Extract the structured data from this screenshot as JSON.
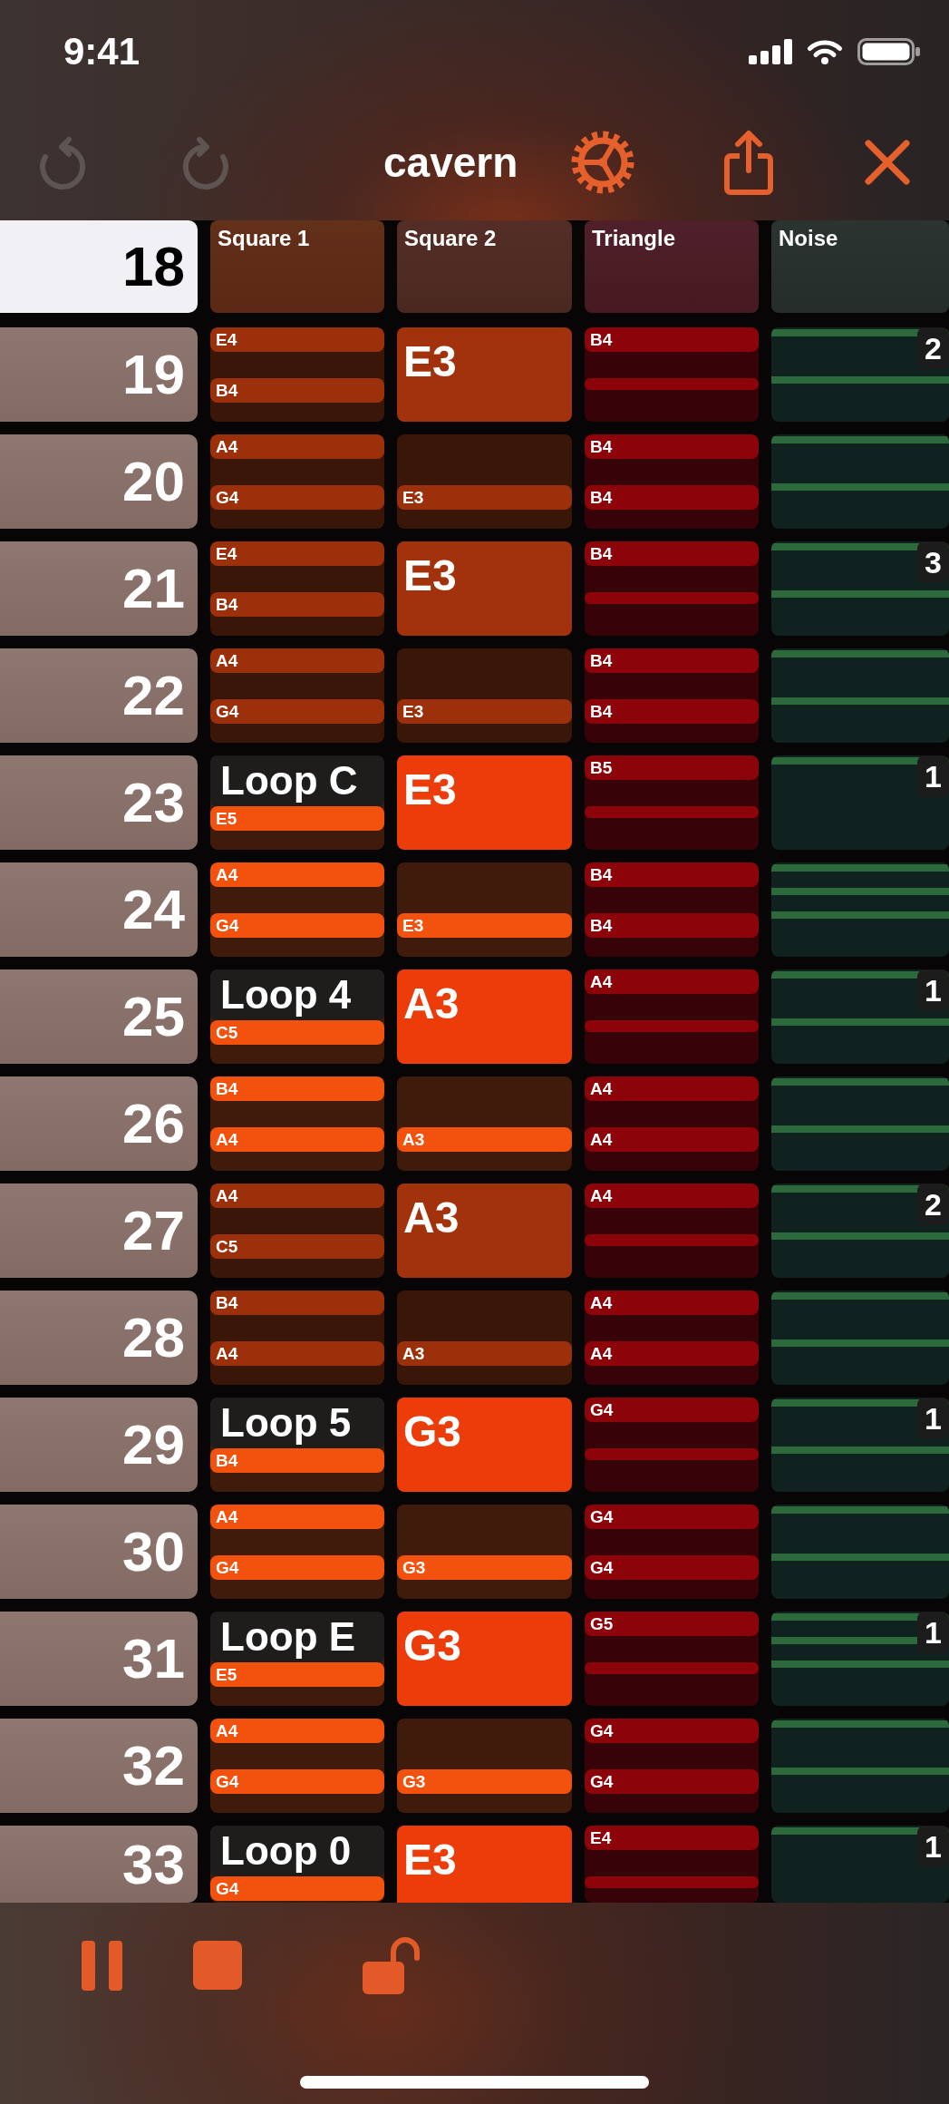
{
  "status_bar": {
    "time": "9:41"
  },
  "toolbar": {
    "undo": {
      "disabled": true
    },
    "redo": {
      "disabled": true
    },
    "title": "cavern"
  },
  "tracker": {
    "current_row": {
      "number": "18",
      "selected": true
    },
    "columns": [
      {
        "kind": "square",
        "label": "Square 1"
      },
      {
        "kind": "square",
        "label": "Square 2"
      },
      {
        "kind": "triangle",
        "label": "Triangle"
      },
      {
        "kind": "noise",
        "label": "Noise"
      }
    ],
    "rows": [
      {
        "number": "19",
        "selected": false,
        "cells": [
          {
            "bright": false,
            "slots": [
              {
                "kind": "note",
                "label": "E4"
              },
              {
                "kind": "note",
                "label": "B4"
              }
            ]
          },
          {
            "bright": false,
            "slots": [
              {
                "kind": "block",
                "label": "E3"
              }
            ]
          },
          {
            "slots": [
              {
                "kind": "note",
                "label": "B4"
              },
              {
                "kind": "bar"
              }
            ]
          },
          {
            "badge": "2",
            "steps": [
              {
                "on": true
              },
              {
                "on": false
              },
              {
                "on": true
              },
              {
                "on": false
              }
            ]
          }
        ]
      },
      {
        "number": "20",
        "selected": false,
        "cells": [
          {
            "bright": false,
            "slots": [
              {
                "kind": "note",
                "label": "A4"
              },
              {
                "kind": "note",
                "label": "G4"
              }
            ]
          },
          {
            "bright": false,
            "slots": [
              {
                "kind": "rest"
              },
              {
                "kind": "note",
                "label": "E3"
              }
            ]
          },
          {
            "slots": [
              {
                "kind": "note",
                "label": "B4"
              },
              {
                "kind": "note",
                "label": "B4"
              }
            ]
          },
          {
            "steps": [
              {
                "on": true
              },
              {
                "on": false
              },
              {
                "on": true
              },
              {
                "on": false
              }
            ]
          }
        ]
      },
      {
        "number": "21",
        "selected": false,
        "cells": [
          {
            "bright": false,
            "slots": [
              {
                "kind": "note",
                "label": "E4"
              },
              {
                "kind": "note",
                "label": "B4"
              }
            ]
          },
          {
            "bright": false,
            "slots": [
              {
                "kind": "block",
                "label": "E3"
              }
            ]
          },
          {
            "slots": [
              {
                "kind": "note",
                "label": "B4"
              },
              {
                "kind": "bar"
              }
            ]
          },
          {
            "badge": "3",
            "steps": [
              {
                "on": true
              },
              {
                "on": false
              },
              {
                "on": true
              },
              {
                "on": false
              }
            ]
          }
        ]
      },
      {
        "number": "22",
        "selected": false,
        "cells": [
          {
            "bright": false,
            "slots": [
              {
                "kind": "note",
                "label": "A4"
              },
              {
                "kind": "note",
                "label": "G4"
              }
            ]
          },
          {
            "bright": false,
            "slots": [
              {
                "kind": "rest"
              },
              {
                "kind": "note",
                "label": "E3"
              }
            ]
          },
          {
            "slots": [
              {
                "kind": "note",
                "label": "B4"
              },
              {
                "kind": "note",
                "label": "B4"
              }
            ]
          },
          {
            "steps": [
              {
                "on": true
              },
              {
                "on": false
              },
              {
                "on": true
              },
              {
                "on": false
              }
            ]
          }
        ]
      },
      {
        "number": "23",
        "selected": false,
        "cells": [
          {
            "bright": true,
            "slots": [
              {
                "kind": "loop",
                "label": "Loop C"
              },
              {
                "kind": "note",
                "label": "E5"
              }
            ]
          },
          {
            "bright": true,
            "slots": [
              {
                "kind": "block",
                "label": "E3"
              }
            ]
          },
          {
            "slots": [
              {
                "kind": "note",
                "label": "B5"
              },
              {
                "kind": "bar"
              }
            ]
          },
          {
            "badge": "1",
            "steps": [
              {
                "on": true
              },
              {
                "on": false
              },
              {
                "on": false
              },
              {
                "on": false
              }
            ]
          }
        ]
      },
      {
        "number": "24",
        "selected": false,
        "cells": [
          {
            "bright": true,
            "slots": [
              {
                "kind": "note",
                "label": "A4"
              },
              {
                "kind": "note",
                "label": "G4"
              }
            ]
          },
          {
            "bright": true,
            "slots": [
              {
                "kind": "rest"
              },
              {
                "kind": "note",
                "label": "E3"
              }
            ]
          },
          {
            "slots": [
              {
                "kind": "note",
                "label": "B4"
              },
              {
                "kind": "note",
                "label": "B4"
              }
            ]
          },
          {
            "steps": [
              {
                "on": true
              },
              {
                "on": true
              },
              {
                "on": true
              },
              {
                "on": false
              }
            ]
          }
        ]
      },
      {
        "number": "25",
        "selected": false,
        "cells": [
          {
            "bright": true,
            "slots": [
              {
                "kind": "loop",
                "label": "Loop 4"
              },
              {
                "kind": "note",
                "label": "C5"
              }
            ]
          },
          {
            "bright": true,
            "slots": [
              {
                "kind": "block",
                "label": "A3"
              }
            ]
          },
          {
            "slots": [
              {
                "kind": "note",
                "label": "A4"
              },
              {
                "kind": "bar"
              }
            ]
          },
          {
            "badge": "1",
            "steps": [
              {
                "on": true
              },
              {
                "on": false
              },
              {
                "on": true
              },
              {
                "on": false
              }
            ]
          }
        ]
      },
      {
        "number": "26",
        "selected": false,
        "cells": [
          {
            "bright": true,
            "slots": [
              {
                "kind": "note",
                "label": "B4"
              },
              {
                "kind": "note",
                "label": "A4"
              }
            ]
          },
          {
            "bright": true,
            "slots": [
              {
                "kind": "rest"
              },
              {
                "kind": "note",
                "label": "A3"
              }
            ]
          },
          {
            "slots": [
              {
                "kind": "note",
                "label": "A4"
              },
              {
                "kind": "note",
                "label": "A4"
              }
            ]
          },
          {
            "steps": [
              {
                "on": true
              },
              {
                "on": false
              },
              {
                "on": true
              },
              {
                "on": false
              }
            ]
          }
        ]
      },
      {
        "number": "27",
        "selected": false,
        "cells": [
          {
            "bright": false,
            "slots": [
              {
                "kind": "note",
                "label": "A4"
              },
              {
                "kind": "note",
                "label": "C5"
              }
            ]
          },
          {
            "bright": false,
            "slots": [
              {
                "kind": "block",
                "label": "A3"
              }
            ]
          },
          {
            "slots": [
              {
                "kind": "note",
                "label": "A4"
              },
              {
                "kind": "bar"
              }
            ]
          },
          {
            "badge": "2",
            "steps": [
              {
                "on": true
              },
              {
                "on": false
              },
              {
                "on": true
              },
              {
                "on": false
              }
            ]
          }
        ]
      },
      {
        "number": "28",
        "selected": false,
        "cells": [
          {
            "bright": false,
            "slots": [
              {
                "kind": "note",
                "label": "B4"
              },
              {
                "kind": "note",
                "label": "A4"
              }
            ]
          },
          {
            "bright": false,
            "slots": [
              {
                "kind": "rest"
              },
              {
                "kind": "note",
                "label": "A3"
              }
            ]
          },
          {
            "slots": [
              {
                "kind": "note",
                "label": "A4"
              },
              {
                "kind": "note",
                "label": "A4"
              }
            ]
          },
          {
            "steps": [
              {
                "on": true
              },
              {
                "on": false
              },
              {
                "on": true
              },
              {
                "on": false
              }
            ]
          }
        ]
      },
      {
        "number": "29",
        "selected": false,
        "cells": [
          {
            "bright": true,
            "slots": [
              {
                "kind": "loop",
                "label": "Loop 5"
              },
              {
                "kind": "note",
                "label": "B4"
              }
            ]
          },
          {
            "bright": true,
            "slots": [
              {
                "kind": "block",
                "label": "G3"
              }
            ]
          },
          {
            "slots": [
              {
                "kind": "note",
                "label": "G4"
              },
              {
                "kind": "bar"
              }
            ]
          },
          {
            "badge": "1",
            "steps": [
              {
                "on": true
              },
              {
                "on": false
              },
              {
                "on": true
              },
              {
                "on": false
              }
            ]
          }
        ]
      },
      {
        "number": "30",
        "selected": false,
        "cells": [
          {
            "bright": true,
            "slots": [
              {
                "kind": "note",
                "label": "A4"
              },
              {
                "kind": "note",
                "label": "G4"
              }
            ]
          },
          {
            "bright": true,
            "slots": [
              {
                "kind": "rest"
              },
              {
                "kind": "note",
                "label": "G3"
              }
            ]
          },
          {
            "slots": [
              {
                "kind": "note",
                "label": "G4"
              },
              {
                "kind": "note",
                "label": "G4"
              }
            ]
          },
          {
            "steps": [
              {
                "on": true
              },
              {
                "on": false
              },
              {
                "on": true
              },
              {
                "on": false
              }
            ]
          }
        ]
      },
      {
        "number": "31",
        "selected": false,
        "cells": [
          {
            "bright": true,
            "slots": [
              {
                "kind": "loop",
                "label": "Loop E"
              },
              {
                "kind": "note",
                "label": "E5"
              }
            ]
          },
          {
            "bright": true,
            "slots": [
              {
                "kind": "block",
                "label": "G3"
              }
            ]
          },
          {
            "slots": [
              {
                "kind": "note",
                "label": "G5"
              },
              {
                "kind": "bar"
              }
            ]
          },
          {
            "badge": "1",
            "steps": [
              {
                "on": true
              },
              {
                "on": true
              },
              {
                "on": true
              },
              {
                "on": false
              }
            ]
          }
        ]
      },
      {
        "number": "32",
        "selected": false,
        "cells": [
          {
            "bright": true,
            "slots": [
              {
                "kind": "note",
                "label": "A4"
              },
              {
                "kind": "note",
                "label": "G4"
              }
            ]
          },
          {
            "bright": true,
            "slots": [
              {
                "kind": "rest"
              },
              {
                "kind": "note",
                "label": "G3"
              }
            ]
          },
          {
            "slots": [
              {
                "kind": "note",
                "label": "G4"
              },
              {
                "kind": "note",
                "label": "G4"
              }
            ]
          },
          {
            "steps": [
              {
                "on": true
              },
              {
                "on": false
              },
              {
                "on": true
              },
              {
                "on": false
              }
            ]
          }
        ]
      },
      {
        "number": "33",
        "selected": false,
        "cells": [
          {
            "bright": true,
            "slots": [
              {
                "kind": "loop",
                "label": "Loop 0"
              },
              {
                "kind": "note",
                "label": "G4"
              }
            ]
          },
          {
            "bright": true,
            "slots": [
              {
                "kind": "block",
                "label": "E3"
              }
            ]
          },
          {
            "slots": [
              {
                "kind": "note",
                "label": "E4"
              },
              {
                "kind": "bar"
              }
            ]
          },
          {
            "badge": "1",
            "steps": [
              {
                "on": true
              },
              {
                "on": false
              },
              {
                "on": false
              },
              {
                "on": false
              }
            ]
          }
        ]
      }
    ]
  },
  "transport": {
    "playing": true,
    "locked": false
  }
}
